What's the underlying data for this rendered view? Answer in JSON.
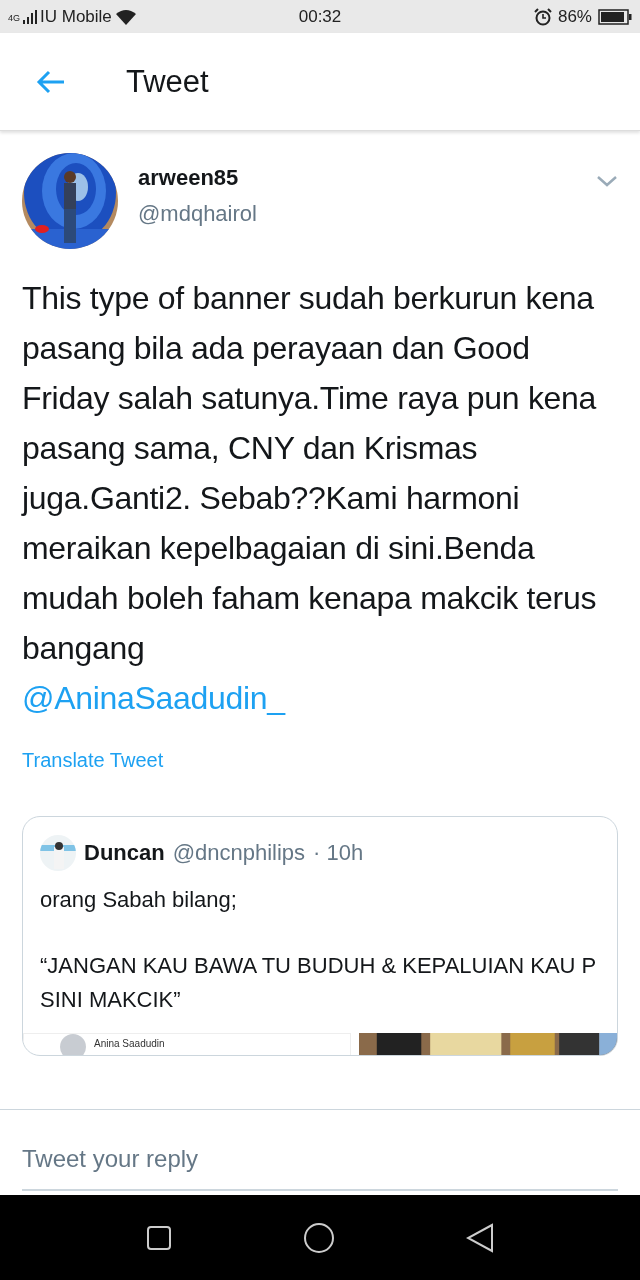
{
  "status_bar": {
    "network": "4G",
    "carrier": "IU Mobile",
    "time": "00:32",
    "battery": "86%"
  },
  "header": {
    "title": "Tweet"
  },
  "tweet": {
    "name": "arween85",
    "handle": "@mdqhairol",
    "text": "This type of banner sudah berkurun kena pasang bila ada perayaan dan Good Friday salah satunya.Time raya pun kena pasang sama, CNY dan Krismas juga.Ganti2. Sebab??Kami harmoni meraikan kepelbagaian di sini.Benda mudah boleh faham kenapa makcik terus bangang",
    "mention": "@AninaSaadudin_",
    "translate": "Translate Tweet",
    "quote": {
      "name": "Duncan",
      "handle": "@dncnphilips",
      "time": "· 10h",
      "lines": [
        "orang Sabah bilang;",
        "“JANGAN KAU BAWA TU BUDUH & KEPALUIAN KAU P SINI MAKCIK”"
      ],
      "embedded_name": "Anina Saadudin"
    }
  },
  "reply": {
    "placeholder": "Tweet your reply"
  }
}
